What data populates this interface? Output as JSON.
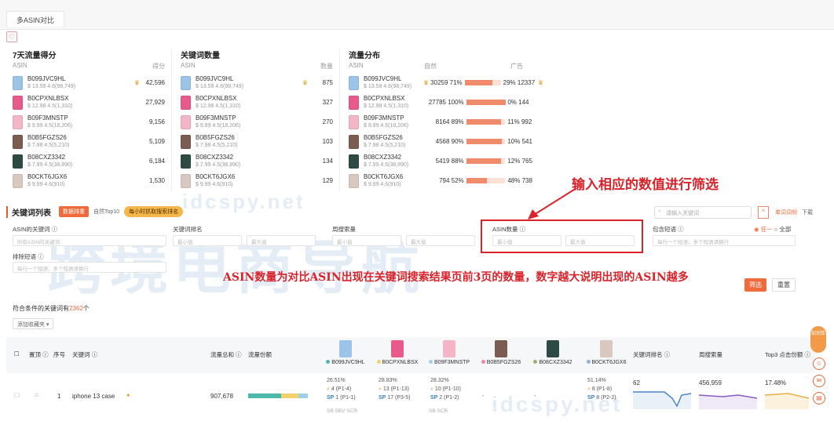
{
  "tab": {
    "label": "多ASIN对比"
  },
  "fav_icon": "heart-icon",
  "panels": {
    "traffic": {
      "title": "7天流量得分",
      "col_left": "ASIN",
      "col_right": "得分"
    },
    "keywords": {
      "title": "关键词数量",
      "col_left": "ASIN",
      "col_right": "数量"
    },
    "flow": {
      "title": "流量分布",
      "col_left": "ASIN",
      "col_mid": "自然",
      "col_right": "广告"
    }
  },
  "products": [
    {
      "asin": "B099JVC9HL",
      "meta": "$ 13.59  4.6(98,749)",
      "score": "42,596",
      "kw": "875",
      "crown": true,
      "natural": "30259",
      "natural_pct": "71%",
      "natural_frac": 0.71,
      "ad": "29% 12337",
      "ad_crown": true,
      "color": "#9cc3e8"
    },
    {
      "asin": "B0CPXNLBSX",
      "meta": "$ 12.98  4.5(1,310)",
      "score": "27,929",
      "kw": "327",
      "crown": false,
      "natural": "27785",
      "natural_pct": "100%",
      "natural_frac": 1.0,
      "ad": "0% 144",
      "ad_crown": false,
      "color": "#e85a8a"
    },
    {
      "asin": "B09F3MNSTP",
      "meta": "$ 9.99  4.5(18,206)",
      "score": "9,156",
      "kw": "270",
      "crown": false,
      "natural": "8164",
      "natural_pct": "89%",
      "natural_frac": 0.89,
      "ad": "11% 992",
      "ad_crown": false,
      "color": "#f4b6c6"
    },
    {
      "asin": "B0B5FGZS26",
      "meta": "$ 7.98  4.5(5,210)",
      "score": "5,109",
      "kw": "103",
      "crown": false,
      "natural": "4568",
      "natural_pct": "90%",
      "natural_frac": 0.9,
      "ad": "10% 541",
      "ad_crown": false,
      "color": "#7a5c50"
    },
    {
      "asin": "B08CXZ3342",
      "meta": "$ 7.99  4.5(38,890)",
      "score": "6,184",
      "kw": "134",
      "crown": false,
      "natural": "5419",
      "natural_pct": "88%",
      "natural_frac": 0.88,
      "ad": "12% 765",
      "ad_crown": false,
      "color": "#2e4a44"
    },
    {
      "asin": "B0CKT6JGX6",
      "meta": "$ 9.99  4.6(910)",
      "score": "1,530",
      "kw": "129",
      "crown": false,
      "natural": "794",
      "natural_pct": "52%",
      "natural_frac": 0.52,
      "ad": "48% 738",
      "ad_crown": false,
      "color": "#d8c8c0"
    }
  ],
  "annotation": {
    "arrow_text": "输入相应的数值进行筛选",
    "note": "ASIN数量为对比ASIN出现在关键词搜索结果页前3页的数量，数字越大说明出现的ASIN越多"
  },
  "kwlist": {
    "title": "关键词列表",
    "pill_active": "数据排重",
    "pill_top": "自然Top10",
    "pill_yellow": "每小时抓取搜索排名",
    "search_placeholder": "请输入关键词",
    "toggle": "^",
    "link_single": "单词词频",
    "link_download": "下载"
  },
  "filters": {
    "asin_kw": {
      "label": "ASIN的关键词 ⓘ",
      "placeholder": "所有ASIN的关键词"
    },
    "kw_rank": {
      "label": "关键词排名",
      "min": "最小值",
      "max": "最大值"
    },
    "search_vol": {
      "label": "周搜索量",
      "min": "最小值",
      "max": "最大值"
    },
    "asin_count": {
      "label": "ASIN数量 ⓘ",
      "min": "最小值",
      "max": "最大值"
    },
    "include": {
      "label": "包含短语 ⓘ",
      "opt1": "任一",
      "opt2": "全部",
      "placeholder": "每行一个短语，多个短语请换行"
    },
    "exclude": {
      "label": "排除短语 ⓘ",
      "placeholder": "每行一个短语，多个短语请换行"
    }
  },
  "buttons": {
    "filter": "筛选",
    "reset": "重置"
  },
  "result": {
    "prefix": "符合条件的关键词有",
    "count": "2362",
    "suffix": "个"
  },
  "add_dims": "添加收藏夹 ▾",
  "table": {
    "headers": {
      "rank_chg": "置顶 ⓘ",
      "no": "序号",
      "kw": "关键词 ⓘ",
      "vol": "流量总和 ⓘ",
      "share": "流量份额",
      "kw_rank": "关键词排名 ⓘ",
      "week_vol": "周搜索量",
      "top3": "Top3 点击份额 ⓘ"
    },
    "row": {
      "no": "1",
      "kw": "iphone 13 case",
      "vol": "907,678",
      "cells": [
        {
          "pct": "26.51%",
          "l1": "4 (P1-4)",
          "l2": "1 (P1-1)"
        },
        {
          "pct": "28.83%",
          "l1": "13 (P1-13)",
          "l2": "17 (P3-5)"
        },
        {
          "pct": "28.32%",
          "l1": "10 (P1-10)",
          "l2": "2 (P1-2)"
        },
        {
          "pct": "-",
          "l1": "",
          "l2": ""
        },
        {
          "pct": "-",
          "l1": "",
          "l2": ""
        },
        {
          "pct": "51.14%",
          "l1": "8 (P1-8)",
          "l2": "8 (P2-2)"
        }
      ],
      "rank": "62",
      "week_vol": "456,959",
      "top3": "17.48%",
      "sub_a": "SB SBV SCR",
      "sub_b": "SB SCR"
    }
  },
  "rail": {
    "top": "知识库"
  },
  "watermark": {
    "cn": "跨境电商导航",
    "url": "idcspy.net"
  }
}
